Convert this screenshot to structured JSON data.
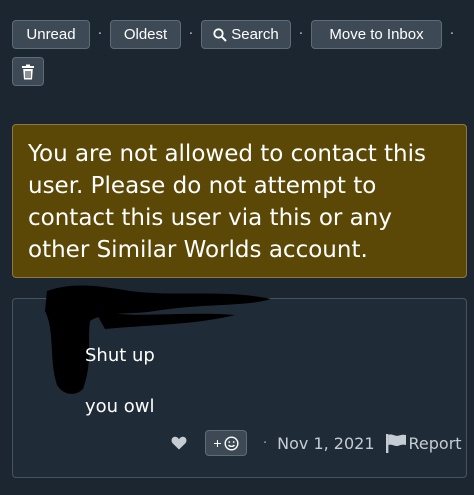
{
  "toolbar": {
    "unread_label": "Unread",
    "oldest_label": "Oldest",
    "search_label": "Search",
    "move_label": "Move to Inbox",
    "separator": "·"
  },
  "warning": {
    "text": "You are not allowed to contact this user. Please do not attempt to contact this user via this or any other Similar Worlds account."
  },
  "message": {
    "lines": [
      "Shut up",
      "you owl"
    ],
    "react_plus": "+",
    "separator": "·",
    "date": "Nov 1, 2021",
    "report_label": "Report"
  },
  "colors": {
    "background": "#1b2630",
    "warning_bg": "#5c4806",
    "button_bg": "#3d4a55",
    "text": "#ffffff"
  }
}
